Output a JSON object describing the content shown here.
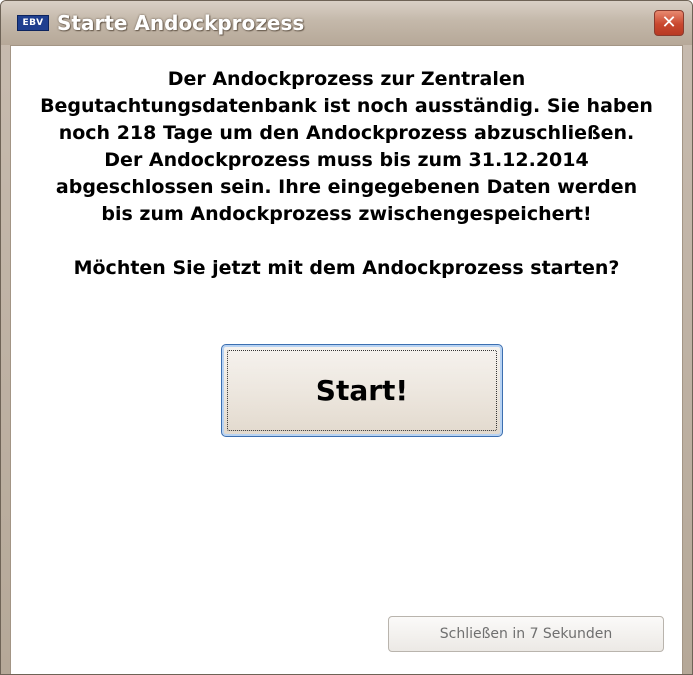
{
  "window": {
    "title": "Starte Andockprozess",
    "app_logo_text": "EBV",
    "close_symbol": "✕"
  },
  "message": {
    "line1": "Der Andockprozess zur Zentralen",
    "line2": "Begutachtungsdatenbank ist noch ausständig. Sie haben",
    "line3": "noch 218 Tage um den Andockprozess abzuschließen.",
    "line4": "Der Andockprozess muss bis zum 31.12.2014",
    "line5": "abgeschlossen sein. Ihre eingegebenen Daten werden",
    "line6": "bis zum Andockprozess zwischengespeichert!",
    "question": "Möchten Sie jetzt mit dem Andockprozess starten?"
  },
  "buttons": {
    "start_label": "Start!",
    "close_timer_label": "Schließen in 7 Sekunden"
  },
  "icons": {
    "app_logo": "ebv-logo-icon",
    "close": "close-icon"
  },
  "colors": {
    "titlebar": "#c4b8aa",
    "close_button": "#c9482f",
    "start_button_border": "#3c6fb0"
  }
}
